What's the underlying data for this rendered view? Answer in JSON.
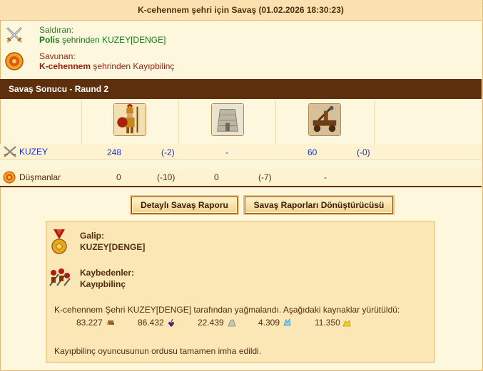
{
  "header": {
    "title": "K-cehennem şehri için Savaş (01.02.2026 18:30:23)"
  },
  "attacker": {
    "label": "Saldıran:",
    "city": "Polis",
    "rest": " şehrinden KUZEY[DENGE]"
  },
  "defender": {
    "label": "Savunan:",
    "city": "K-cehennem",
    "rest": " şehrinden Kayıpbilinç"
  },
  "result": {
    "title": "Savaş Sonucu - Raund 2"
  },
  "units": [
    {
      "name": "hoplite",
      "icon": "hoplite-icon"
    },
    {
      "name": "wall",
      "icon": "wall-icon"
    },
    {
      "name": "catapult",
      "icon": "catapult-icon"
    }
  ],
  "rows": {
    "attacker": {
      "name": "KUZEY",
      "c1": "248",
      "c1d": "(-2)",
      "c2": "-",
      "c3": "60",
      "c3d": "(-0)"
    },
    "enemies": {
      "name": "Düşmanlar",
      "c1": "0",
      "c1d": "(-10)",
      "c2": "0",
      "c2d": "(-7)",
      "c3": "-"
    }
  },
  "buttons": {
    "detail": "Detaylı Savaş Raporu",
    "converter": "Savaş Raporları Dönüştürücüsü"
  },
  "summary": {
    "winner_label": "Galip:",
    "winner": "KUZEY[DENGE]",
    "loser_label": "Kaybedenler:",
    "loser": "Kayıpbilinç",
    "plunder_text": "K-cehennem Şehri KUZEY[DENGE] tarafından yağmalandı. Aşağıdaki kaynaklar yürütüldü:",
    "resources": [
      {
        "value": "83.227",
        "icon": "wood-icon"
      },
      {
        "value": "86.432",
        "icon": "wine-icon"
      },
      {
        "value": "22.439",
        "icon": "marble-icon"
      },
      {
        "value": "4.309",
        "icon": "crystal-icon"
      },
      {
        "value": "11.350",
        "icon": "sulfur-icon"
      }
    ],
    "footer": "Kayıpbilinç oyuncusunun ordusu tamamen imha edildi."
  },
  "colors": {
    "result_bar": "#5e2f0d",
    "attacker_green": "#1a7a1a",
    "defender_red": "#9a1f0e",
    "link_blue": "#1b2ed6"
  }
}
